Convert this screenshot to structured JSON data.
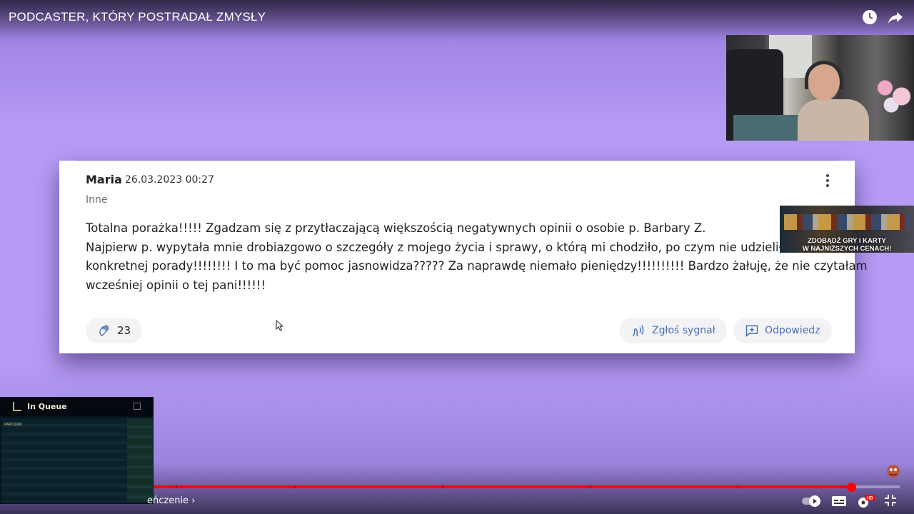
{
  "video": {
    "title": "PODCASTER, KTÓRY POSTRADAŁ ZMYSŁY",
    "icons": [
      "watch-later-icon",
      "share-icon"
    ],
    "progress_fraction": 0.935,
    "chapter_label": "eńczenie ›"
  },
  "review": {
    "author": "Maria",
    "date": "26.03.2023 00:27",
    "category": "Inne",
    "lines": [
      "Totalna porażka!!!!! Zgadzam się z przytłaczającą większością negatywnych opinii o osobie p. Barbary Z.",
      "Najpierw p. wypytała mnie drobiazgowo o szczegóły z mojego życia i sprawy, o którą mi chodziło, po czym nie udzieliła ż",
      "konkretnej porady!!!!!!!! I to ma być pomoc jasnowidza????? Za naprawdę niemało pieniędzy!!!!!!!!!! Bardzo żałuję, że nie czytałam",
      "wcześniej opinii o tej pani!!!!!!"
    ],
    "likes": "23",
    "report_label": "Zgłoś sygnał",
    "reply_label": "Odpowiedz"
  },
  "ad": {
    "line1": "ZDOBĄDŹ GRY I KARTY",
    "line2": "W NAJNIŻSZYCH CENACH!"
  },
  "league": {
    "status": "In Queue",
    "subtitle": "PARTIZAN"
  },
  "colors": {
    "accent_red": "#ff0000",
    "link_blue": "#4b6fb5",
    "background_purple": "#b59bf4"
  }
}
